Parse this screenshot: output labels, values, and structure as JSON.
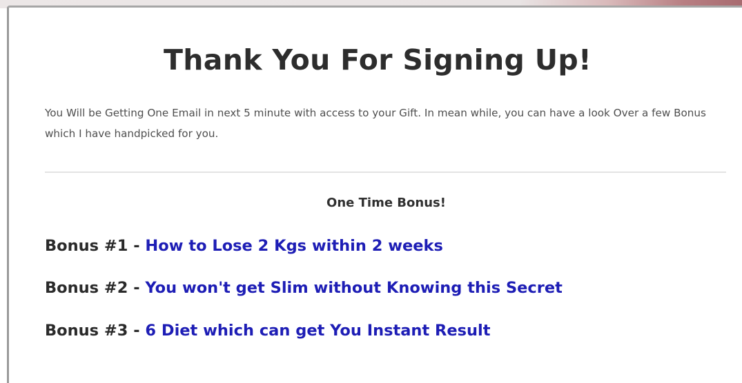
{
  "header": {
    "title": "Thank You For Signing Up!"
  },
  "intro": {
    "text": "You Will be Getting One Email in next 5 minute with access to your Gift. In mean while, you can have a look Over a few Bonus which I have handpicked for you."
  },
  "bonus_section": {
    "heading": "One Time Bonus!",
    "separator": " - ",
    "items": [
      {
        "label": "Bonus #1",
        "link_text": "How to Lose 2 Kgs within 2 weeks"
      },
      {
        "label": "Bonus #2",
        "link_text": "You won't get Slim without Knowing this Secret"
      },
      {
        "label": "Bonus #3",
        "link_text": "6 Diet which can get You Instant Result"
      }
    ]
  },
  "colors": {
    "link": "#1d1db5",
    "text": "#2a2a2a",
    "body_text": "#4e4e4e"
  }
}
